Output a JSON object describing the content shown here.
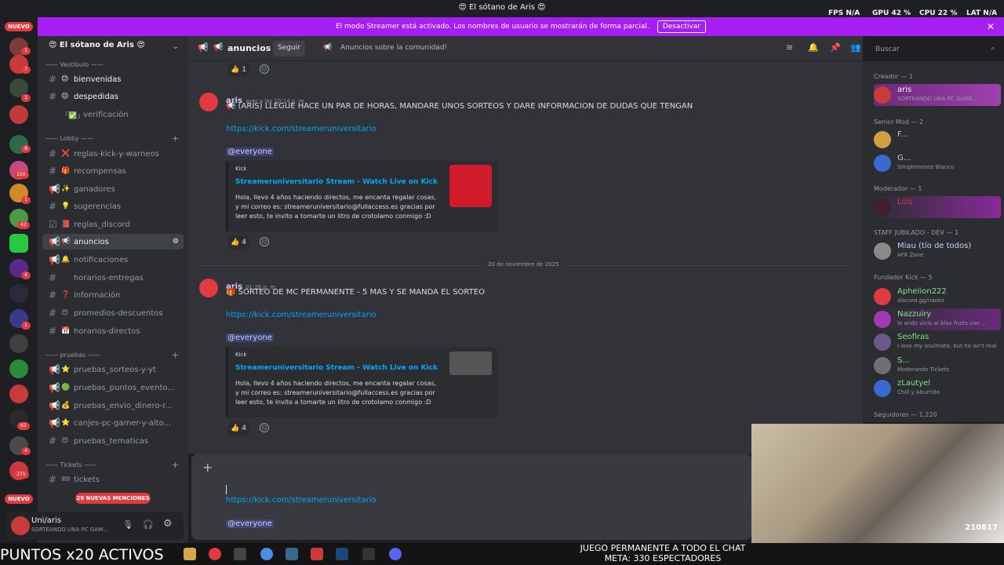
{
  "window": {
    "title": "😍 El sótano de Aris 😍",
    "fps_label": "FPS",
    "fps_value": "N/A",
    "gpu_label": "GPU",
    "gpu_value": "42 %",
    "cpu_label": "CPU",
    "cpu_value": "22 %",
    "lat_label": "LAT",
    "lat_value": "N/A"
  },
  "banner": {
    "text": "El modo Streamer está activado. Los nombres de usuario se mostrarán de forma parcial.",
    "button": "Desactivar",
    "close": "✕"
  },
  "rail": {
    "nuevo_top": "NUEVO",
    "nuevo_bottom": "NUEVO",
    "badges": [
      "1",
      "7",
      "1",
      "8",
      "220",
      "1",
      "42",
      "4",
      "1",
      "62",
      "4",
      "271"
    ]
  },
  "server": {
    "name": "😍 El sótano de Aris 😍"
  },
  "sidebar": {
    "categories": [
      "Vestibulo",
      "Lobby",
      "pruebas",
      "Tickets"
    ],
    "channels": [
      {
        "icon": "#",
        "emoji": "😊",
        "name": "bienvenidas",
        "bold": true
      },
      {
        "icon": "#",
        "emoji": "😔",
        "name": "despedidas",
        "bold": true
      },
      {
        "icon": "",
        "emoji": "「✅」",
        "name": "verificación"
      },
      {
        "icon": "#",
        "emoji": "❌",
        "name": "reglas-kick-y-warneos"
      },
      {
        "icon": "#",
        "emoji": "🎁",
        "name": "recompensas"
      },
      {
        "icon": "📢",
        "emoji": "✨",
        "name": "ganadores"
      },
      {
        "icon": "#",
        "emoji": "💡",
        "name": "sugerencias"
      },
      {
        "icon": "☑",
        "emoji": "📕",
        "name": "reglas_discord"
      },
      {
        "icon": "📢",
        "emoji": "📢",
        "name": "anuncios",
        "active": true
      },
      {
        "icon": "📢",
        "emoji": "🔔",
        "name": "notificaciones"
      },
      {
        "icon": "#",
        "emoji": "",
        "name": "horarios-entregas"
      },
      {
        "icon": "#",
        "emoji": "❓",
        "name": "información"
      },
      {
        "icon": "#",
        "emoji": "😍",
        "name": "promedios-descuentos"
      },
      {
        "icon": "#",
        "emoji": "📅",
        "name": "horarios-directos"
      },
      {
        "icon": "📢",
        "emoji": "⭐",
        "name": "pruebas_sorteos-y-yt"
      },
      {
        "icon": "📢",
        "emoji": "🟢",
        "name": "pruebas_puntos_evento..."
      },
      {
        "icon": "📢",
        "emoji": "💰",
        "name": "pruebas_envio_dinero-r..."
      },
      {
        "icon": "📢",
        "emoji": "⭐",
        "name": "canjes-pc-gamer-y-alto..."
      },
      {
        "icon": "#",
        "emoji": "😍",
        "name": "pruebas_tematicas"
      },
      {
        "icon": "#",
        "emoji": "🎟",
        "name": "tickets"
      }
    ],
    "mentions": "29 NUEVAS MENCIONES"
  },
  "user": {
    "name": "Uni/aris",
    "status": "SORTEANDO UNA PC GAM..."
  },
  "header": {
    "channel": "anuncios",
    "follow": "Seguir",
    "topic": "Anuncios sobre la comunidad!",
    "search_placeholder": "Buscar"
  },
  "messages": [
    {
      "reaction_count": "1"
    },
    {
      "author": "aris",
      "time": "ayer a las 10:14 p. m.",
      "text": "📢 (ARIS) LLEGUE HACE UN PAR DE HORAS, MANDARE UNOS SORTEOS Y DARE INFORMACION DE DUDAS QUE TENGAN",
      "link": "https://kick.com/streameruniversitario",
      "mention": "@everyone",
      "embed": {
        "provider": "Kick",
        "title": "Streameruniversitario Stream - Watch Live on Kick",
        "desc": "Hola, llevo 4 años haciendo directos, me encanta regalar cosas, y mi correo es: streameruniversitario@fullaccess.es gracias por leer esto, te invito a tomarte un litro de crotolamo conmigo :D"
      },
      "reaction_count": "4"
    },
    {
      "author": "aris",
      "time": "01:26 p. m.",
      "text": "🎁 SORTEO DE MC PERMANENTE - 5 MAS Y SE MANDA EL SORTEO",
      "link": "https://kick.com/streameruniversitario",
      "mention": "@everyone",
      "embed": {
        "provider": "Kick",
        "title": "Streameruniversitario Stream - Watch Live on Kick",
        "desc": "Hola, llevo 4 años haciendo directos, me encanta regalar cosas, y mi correo es: streameruniversitario@fullaccess.es gracias por leer esto, te invito a tomarte un litro de crotolamo conmigo :D"
      },
      "reaction_count": "4"
    }
  ],
  "divider": "20 de noviembre de 2025",
  "composer": {
    "link": "https://kick.com/streameruniversitario",
    "mention": "@everyone"
  },
  "members": [
    {
      "group": "Creador — 1",
      "people": [
        {
          "name": "aris",
          "status": "SORTEANDO UNA PC GAME...",
          "color": "#f2f3f5"
        }
      ]
    },
    {
      "group": "Senior Mod — 2",
      "people": [
        {
          "name": "F...",
          "status": "",
          "color": "#e0a0ff"
        },
        {
          "name": "G...",
          "status": "Simplemente Blanco",
          "color": "#f2f3f5"
        }
      ]
    },
    {
      "group": "Moderador — 1",
      "people": [
        {
          "name": "Luis",
          "status": "",
          "color": "#e13a40"
        }
      ]
    },
    {
      "group": "STAFF JUBILADO - DEV — 1",
      "people": [
        {
          "name": "Miau (tío de todos)",
          "status": "AFK Zone",
          "color": "#c9cdfb"
        }
      ]
    },
    {
      "group": "Fundador Kick — 5",
      "people": [
        {
          "name": "Aphelion222",
          "status": "discord.gg/naoko",
          "color": "#7ee787"
        },
        {
          "name": "Nazzuiry",
          "status": "le ando vicio al blox fruits con ...",
          "color": "#7ee787"
        },
        {
          "name": "Seofiras",
          "status": "I love my soulmate, but he isn't real",
          "color": "#7ee787"
        },
        {
          "name": "S...",
          "status": "Moderando Tickets",
          "color": "#7ee787"
        },
        {
          "name": "zLautyel",
          "status": "Chill y Aburrido",
          "color": "#7ee787"
        }
      ]
    },
    {
      "group": "Seguidores — 1,220",
      "people": []
    }
  ],
  "overlay": {
    "left": "PUNTOS x20 ACTIVOS",
    "right_line1": "JUEGO PERMANENTE A TODO EL CHAT",
    "right_line2": "META: 330 ESPECTADORES",
    "webcam_count": "210817"
  }
}
